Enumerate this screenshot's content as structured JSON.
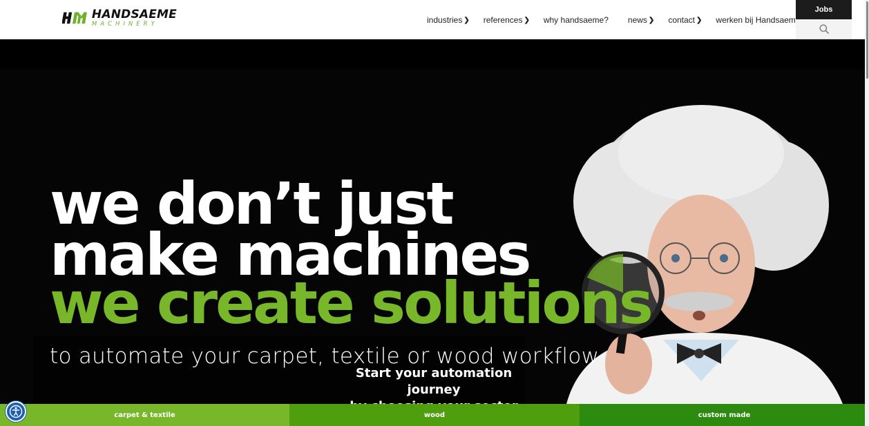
{
  "header": {
    "logo": {
      "top": "HANDSAEME",
      "bottom": "MACHINERY"
    },
    "nav": [
      {
        "label": "industries",
        "has_arrow": true
      },
      {
        "label": "references",
        "has_arrow": true
      },
      {
        "label": "why handsaeme?",
        "has_arrow": false
      },
      {
        "label": "news",
        "has_arrow": true
      },
      {
        "label": "contact",
        "has_arrow": true
      },
      {
        "label": "werken bij Handsaeme",
        "has_arrow": false
      }
    ],
    "jobs_label": "Jobs",
    "search_icon": "search-icon"
  },
  "hero": {
    "headline_line1": "we don’t just",
    "headline_line2": "make machines",
    "headline_line3": "we create solutions",
    "subline": "to automate your carpet, textile or wood workflow",
    "cta_line1": "Start your automation journey",
    "cta_line2": "by choosing your sector",
    "image": "scientist-with-magnifying-glass"
  },
  "sectors": [
    {
      "label": "carpet & textile",
      "color": "#78b72a"
    },
    {
      "label": "wood",
      "color": "#4f9e0e"
    },
    {
      "label": "custom made",
      "color": "#2c8a0f"
    }
  ],
  "colors": {
    "accent_green": "#78b72a",
    "hero_bg": "#050505",
    "jobs_bg": "#1c1c1c"
  },
  "accessibility_icon": "accessibility-icon"
}
